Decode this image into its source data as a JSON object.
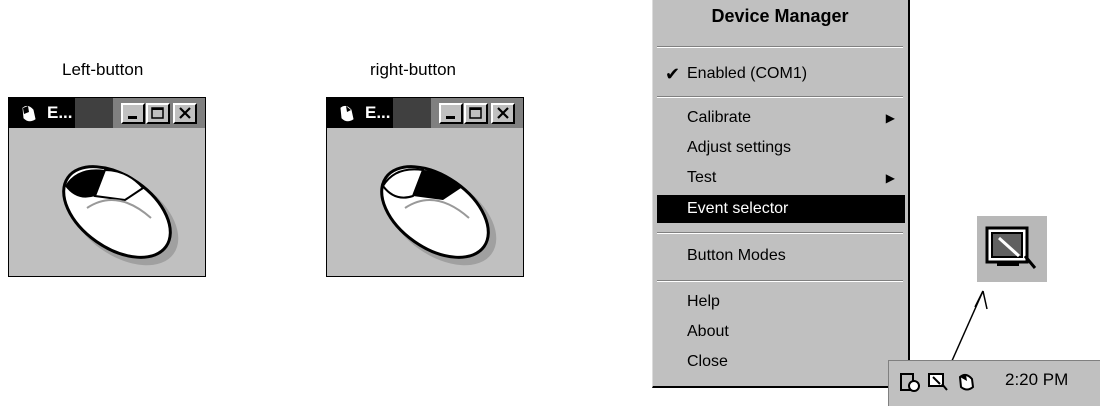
{
  "captions": {
    "left": "Left-button",
    "right": "right-button"
  },
  "mini_windows": [
    {
      "title": "E...",
      "highlight": "left"
    },
    {
      "title": "E...",
      "highlight": "right"
    }
  ],
  "menu": {
    "header": "Device Manager",
    "items": [
      {
        "label": "Enabled (COM1)",
        "checked": true
      },
      {
        "label": "Calibrate",
        "submenu": true
      },
      {
        "label": "Adjust settings"
      },
      {
        "label": "Test",
        "submenu": true
      },
      {
        "label": "Event selector",
        "selected": true
      },
      {
        "label": "Button Modes"
      },
      {
        "label": "Help"
      },
      {
        "label": "About"
      },
      {
        "label": "Close"
      }
    ],
    "submenu_arrow": "▶",
    "check_mark": "✔"
  },
  "tray": {
    "time": "2:20 PM"
  },
  "colors": {
    "menu_bg": "#c0c0c0",
    "highlight": "#000000"
  }
}
